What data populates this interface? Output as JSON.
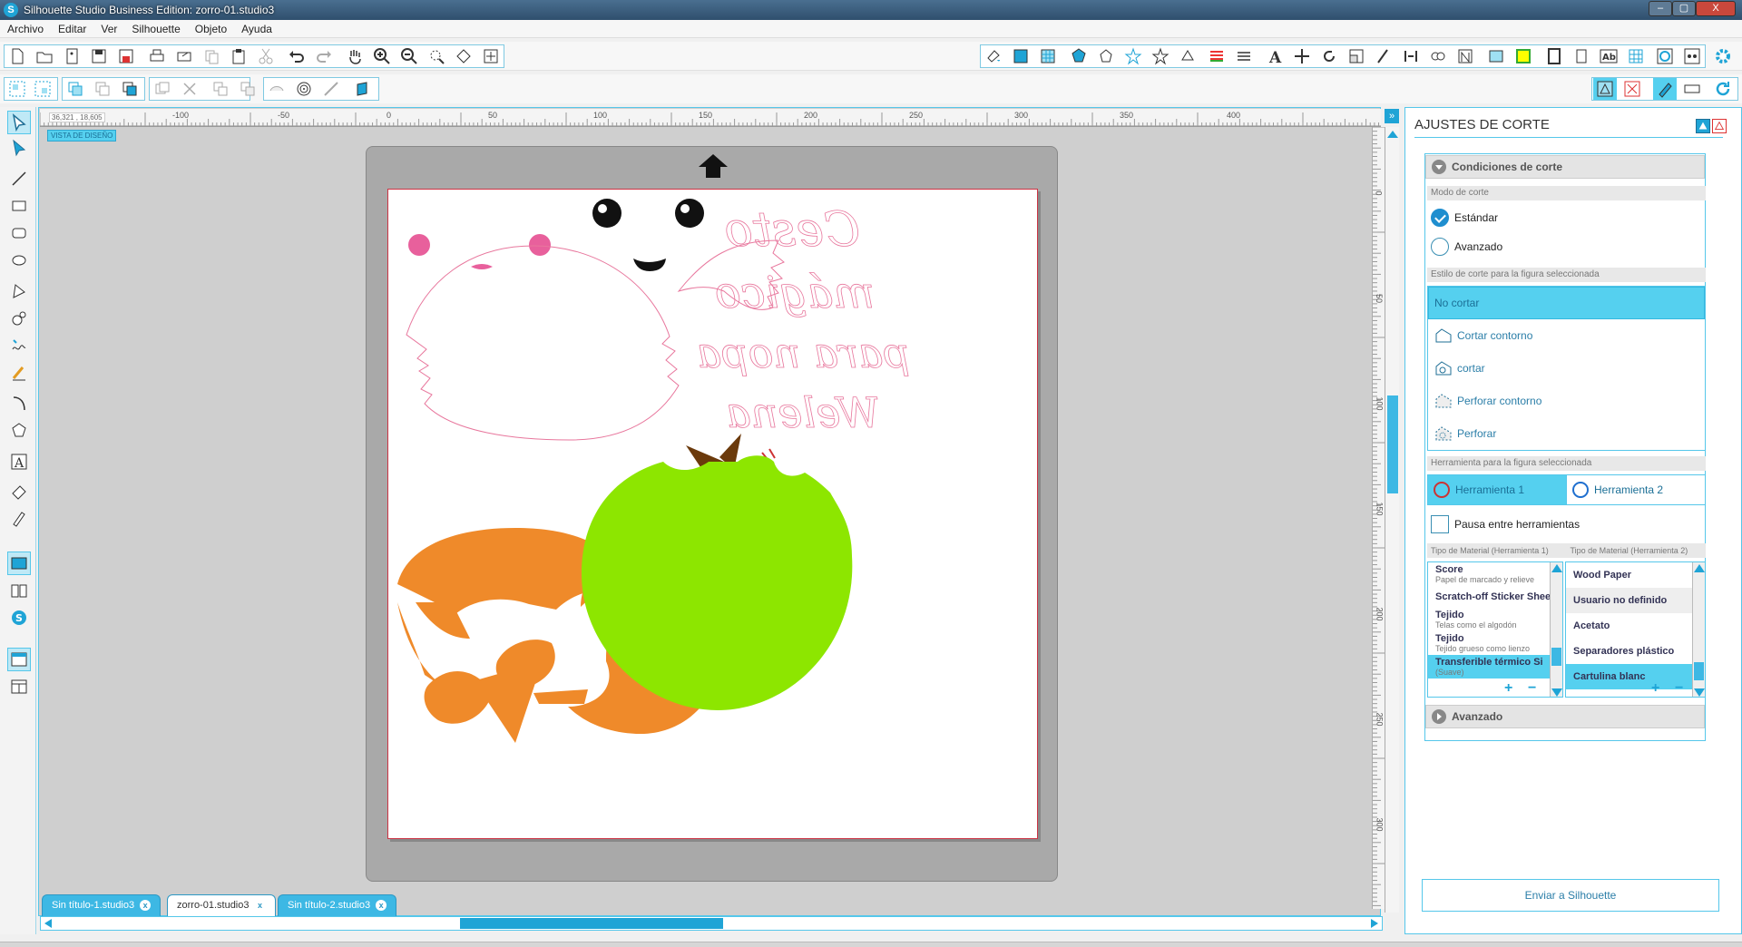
{
  "window": {
    "title": "Silhouette Studio Business Edition: zorro-01.studio3",
    "logo": "S",
    "min": "–",
    "max": "▢",
    "close": "X"
  },
  "menu": [
    "Archivo",
    "Editar",
    "Ver",
    "Silhouette",
    "Objeto",
    "Ayuda"
  ],
  "ruler": {
    "coords": "36,321 , 18,605",
    "h_ticks": [
      "-100",
      "-50",
      "0",
      "50",
      "100",
      "150",
      "200",
      "250",
      "300",
      "350",
      "400"
    ],
    "v_ticks": [
      "0",
      "50",
      "100",
      "150",
      "200",
      "250",
      "300"
    ]
  },
  "canvas": {
    "view_label": "VISTA DE DISEÑO",
    "text_lines": [
      "Cesto",
      "mágico",
      "para nopa",
      "Welena"
    ]
  },
  "colors": {
    "accent": "#1fa4d6",
    "panel_border": "#55c7ea",
    "orange": "#ef8a2a",
    "green": "#8de600",
    "brown": "#6b3a0c",
    "pink": "#e8609c"
  },
  "panel": {
    "title": "AJUSTES DE CORTE",
    "section_cut": "Condiciones de corte",
    "mode_label": "Modo de corte",
    "mode_standard": "Estándar",
    "mode_advanced": "Avanzado",
    "style_label": "Estilo de corte para la figura seleccionada",
    "styles": [
      "No cortar",
      "Cortar contorno",
      "cortar",
      "Perforar contorno",
      "Perforar"
    ],
    "tool_label": "Herramienta para la figura seleccionada",
    "tool1": "Herramienta 1",
    "tool2": "Herramienta 2",
    "pause": "Pausa entre herramientas",
    "mat_label1": "Tipo de Material (Herramienta 1)",
    "mat_label2": "Tipo de Material (Herramienta 2)",
    "materials1": [
      {
        "name": "Score",
        "desc": "Papel de marcado y relieve"
      },
      {
        "name": "Scratch-off Sticker Shee",
        "desc": ""
      },
      {
        "name": "Tejido",
        "desc": "Telas como el algodón"
      },
      {
        "name": "Tejido",
        "desc": "Tejido grueso como lienzo"
      },
      {
        "name": "Transferible térmico Si",
        "desc": "(Suave)"
      }
    ],
    "materials2": [
      "Wood Paper",
      "Usuario no definido",
      "Acetato",
      "Separadores plástico",
      "Cartulina blanc"
    ],
    "add": "+",
    "remove": "−",
    "section_adv": "Avanzado",
    "send": "Enviar a Silhouette"
  },
  "tabs": [
    {
      "label": "Sin título-1.studio3",
      "close": "x"
    },
    {
      "label": "zorro-01.studio3",
      "close": "x"
    },
    {
      "label": "Sin título-2.studio3",
      "close": "x"
    }
  ]
}
